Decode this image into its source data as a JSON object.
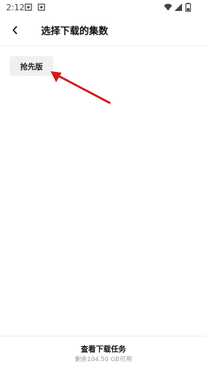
{
  "status_bar": {
    "time": "2:12",
    "icons": [
      "notification-icon",
      "notification-icon",
      "wifi-icon",
      "signal-icon",
      "battery-icon"
    ]
  },
  "header": {
    "back_icon": "chevron-left-icon",
    "title": "选择下载的集数"
  },
  "episodes": [
    {
      "label": "抢先版"
    }
  ],
  "annotation": {
    "color": "#d41a1a"
  },
  "footer": {
    "action_label": "查看下载任务",
    "storage_text": "剩余104.50 GB可用"
  }
}
